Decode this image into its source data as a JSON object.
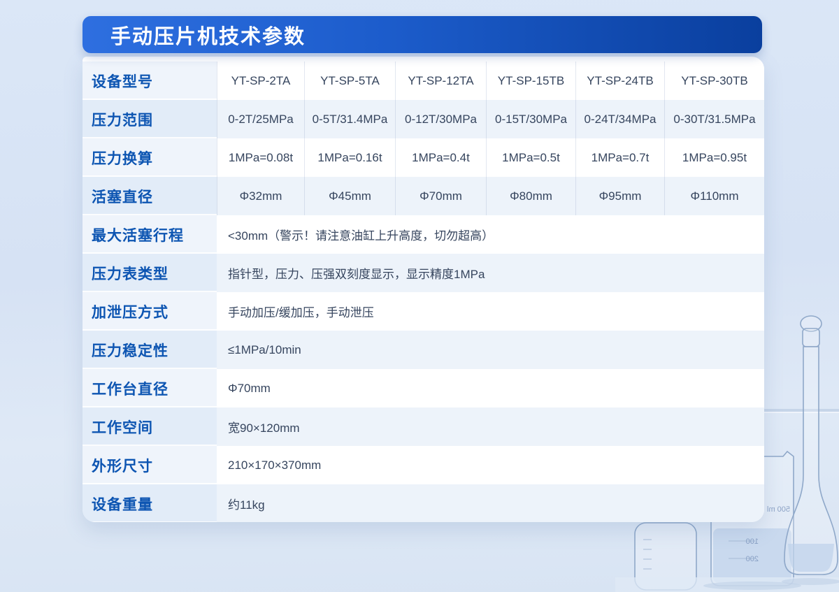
{
  "page": {
    "title": "手动压片机技术参数"
  },
  "table": {
    "grid_rows": [
      {
        "label": "设备型号",
        "values": [
          "YT-SP-2TA",
          "YT-SP-5TA",
          "YT-SP-12TA",
          "YT-SP-15TB",
          "YT-SP-24TB",
          "YT-SP-30TB"
        ]
      },
      {
        "label": "压力范围",
        "values": [
          "0-2T/25MPa",
          "0-5T/31.4MPa",
          "0-12T/30MPa",
          "0-15T/30MPa",
          "0-24T/34MPa",
          "0-30T/31.5MPa"
        ]
      },
      {
        "label": "压力换算",
        "values": [
          "1MPa=0.08t",
          "1MPa=0.16t",
          "1MPa=0.4t",
          "1MPa=0.5t",
          "1MPa=0.7t",
          "1MPa=0.95t"
        ]
      },
      {
        "label": "活塞直径",
        "values": [
          "Φ32mm",
          "Φ45mm",
          "Φ70mm",
          "Φ80mm",
          "Φ95mm",
          "Φ110mm"
        ]
      }
    ],
    "span_rows": [
      {
        "label": "最大活塞行程",
        "value": "<30mm（警示！请注意油缸上升高度，切勿超高）"
      },
      {
        "label": "压力表类型",
        "value": "指针型，压力、压强双刻度显示，显示精度1MPa"
      },
      {
        "label": "加泄压方式",
        "value": "手动加压/缓加压，手动泄压"
      },
      {
        "label": "压力稳定性",
        "value": "≤1MPa/10min"
      },
      {
        "label": "工作台直径",
        "value": "Φ70mm"
      },
      {
        "label": "工作空间",
        "value": "宽90×120mm"
      },
      {
        "label": "外形尺寸",
        "value": "210×170×370mm"
      },
      {
        "label": "设备重量",
        "value": "约11kg"
      }
    ]
  },
  "background": {
    "beaker_volume_label": "500 ml",
    "beaker_scale_marks": [
      "200",
      "100"
    ]
  },
  "colors": {
    "banner_gradient_start": "#2E6FE0",
    "banner_gradient_end": "#0A3F9E",
    "label_text": "#0D55B2",
    "value_text": "#36455E",
    "row_alt_bg": "#EDF3FA",
    "label_cell_bg": "#EFF4FB",
    "page_bg": "#D9E5F6"
  }
}
